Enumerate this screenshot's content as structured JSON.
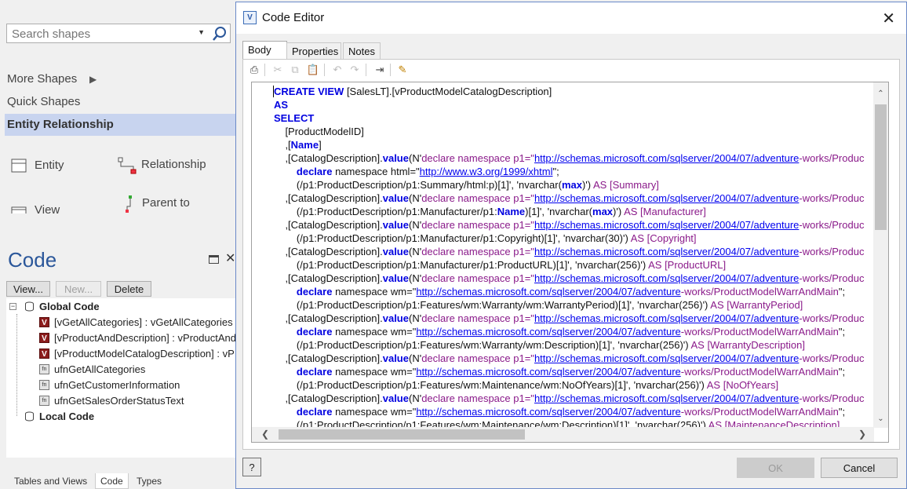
{
  "shapes_panel": {
    "search_placeholder": "Search shapes",
    "more_shapes": "More Shapes",
    "quick_shapes": "Quick Shapes",
    "entity_relationship": "Entity Relationship",
    "stencil": {
      "entity": "Entity",
      "relationship": "Relationship",
      "view": "View",
      "parent_to": "Parent to"
    }
  },
  "code_panel": {
    "title": "Code",
    "buttons": {
      "view": "View...",
      "new": "New...",
      "delete": "Delete"
    },
    "tree": {
      "global": "Global Code",
      "items": [
        "[vGetAllCategories] : vGetAllCategories",
        "[vProductAndDescription] : vProductAnd",
        "[vProductModelCatalogDescription] : vP",
        "ufnGetAllCategories",
        "ufnGetCustomerInformation",
        "ufnGetSalesOrderStatusText"
      ],
      "local": "Local Code"
    },
    "bottom_tabs": {
      "tables": "Tables and Views",
      "code": "Code",
      "types": "Types"
    }
  },
  "dialog": {
    "title": "Code Editor",
    "app_icon": "V",
    "tabs": {
      "body": "Body",
      "properties": "Properties",
      "notes": "Notes"
    },
    "toolbar_icons": [
      "print-icon",
      "cut-icon",
      "copy-icon",
      "paste-icon",
      "undo-icon",
      "redo-icon",
      "indent-icon",
      "highlight-pen-icon"
    ],
    "code_lines": [
      [
        {
          "t": "CREATE VIEW",
          "c": "kw"
        },
        {
          "t": " [SalesLT].[vProductModelCatalogDescription]",
          "c": "pun"
        }
      ],
      [
        {
          "t": "AS",
          "c": "kw"
        }
      ],
      [
        {
          "t": "SELECT",
          "c": "kw"
        }
      ],
      [
        {
          "t": "    [ProductModelID]",
          "c": "pun"
        }
      ],
      [
        {
          "t": "    ,[",
          "c": "pun"
        },
        {
          "t": "Name",
          "c": "kw"
        },
        {
          "t": "]",
          "c": "pun"
        }
      ],
      [
        {
          "t": "    ,[CatalogDescription].",
          "c": "pun"
        },
        {
          "t": "value",
          "c": "kw"
        },
        {
          "t": "(N'",
          "c": "pun"
        },
        {
          "t": "declare namespace p1=\"",
          "c": "str"
        },
        {
          "t": "http://schemas.microsoft.com/sqlserver/2004/07/adventure",
          "c": "url"
        },
        {
          "t": "-works/Produc",
          "c": "str"
        }
      ],
      [
        {
          "t": "        ",
          "c": "pun"
        },
        {
          "t": "declare",
          "c": "kw"
        },
        {
          "t": " namespace html=\"",
          "c": "pun"
        },
        {
          "t": "http://www.w3.org/1999/xhtml",
          "c": "url"
        },
        {
          "t": "\";",
          "c": "pun"
        }
      ],
      [
        {
          "t": "        (/p1:ProductDescription/p1:Summary/html:p)[1]', 'nvarchar(",
          "c": "pun"
        },
        {
          "t": "max",
          "c": "kw"
        },
        {
          "t": ")') ",
          "c": "pun"
        },
        {
          "t": "AS [Summary]",
          "c": "str"
        }
      ],
      [
        {
          "t": "    ,[CatalogDescription].",
          "c": "pun"
        },
        {
          "t": "value",
          "c": "kw"
        },
        {
          "t": "(N'",
          "c": "pun"
        },
        {
          "t": "declare namespace p1=\"",
          "c": "str"
        },
        {
          "t": "http://schemas.microsoft.com/sqlserver/2004/07/adventure",
          "c": "url"
        },
        {
          "t": "-works/Produc",
          "c": "str"
        }
      ],
      [
        {
          "t": "        (/p1:ProductDescription/p1:Manufacturer/p1:",
          "c": "pun"
        },
        {
          "t": "Name",
          "c": "kw"
        },
        {
          "t": ")[1]', 'nvarchar(",
          "c": "pun"
        },
        {
          "t": "max",
          "c": "kw"
        },
        {
          "t": ")') ",
          "c": "pun"
        },
        {
          "t": "AS [Manufacturer]",
          "c": "str"
        }
      ],
      [
        {
          "t": "    ,[CatalogDescription].",
          "c": "pun"
        },
        {
          "t": "value",
          "c": "kw"
        },
        {
          "t": "(N'",
          "c": "pun"
        },
        {
          "t": "declare namespace p1=\"",
          "c": "str"
        },
        {
          "t": "http://schemas.microsoft.com/sqlserver/2004/07/adventure",
          "c": "url"
        },
        {
          "t": "-works/Produc",
          "c": "str"
        }
      ],
      [
        {
          "t": "        (/p1:ProductDescription/p1:Manufacturer/p1:Copyright)[1]', 'nvarchar(30)') ",
          "c": "pun"
        },
        {
          "t": "AS [Copyright]",
          "c": "str"
        }
      ],
      [
        {
          "t": "    ,[CatalogDescription].",
          "c": "pun"
        },
        {
          "t": "value",
          "c": "kw"
        },
        {
          "t": "(N'",
          "c": "pun"
        },
        {
          "t": "declare namespace p1=\"",
          "c": "str"
        },
        {
          "t": "http://schemas.microsoft.com/sqlserver/2004/07/adventure",
          "c": "url"
        },
        {
          "t": "-works/Produc",
          "c": "str"
        }
      ],
      [
        {
          "t": "        (/p1:ProductDescription/p1:Manufacturer/p1:ProductURL)[1]', 'nvarchar(256)') ",
          "c": "pun"
        },
        {
          "t": "AS [ProductURL]",
          "c": "str"
        }
      ],
      [
        {
          "t": "    ,[CatalogDescription].",
          "c": "pun"
        },
        {
          "t": "value",
          "c": "kw"
        },
        {
          "t": "(N'",
          "c": "pun"
        },
        {
          "t": "declare namespace p1=\"",
          "c": "str"
        },
        {
          "t": "http://schemas.microsoft.com/sqlserver/2004/07/adventure",
          "c": "url"
        },
        {
          "t": "-works/Produc",
          "c": "str"
        }
      ],
      [
        {
          "t": "        ",
          "c": "pun"
        },
        {
          "t": "declare",
          "c": "kw"
        },
        {
          "t": " namespace wm=\"",
          "c": "pun"
        },
        {
          "t": "http://schemas.microsoft.com/sqlserver/2004/07/adventure",
          "c": "url"
        },
        {
          "t": "-works/ProductModelWarrAndMain",
          "c": "str"
        },
        {
          "t": "\";",
          "c": "pun"
        }
      ],
      [
        {
          "t": "        (/p1:ProductDescription/p1:Features/wm:Warranty/wm:WarrantyPeriod)[1]', 'nvarchar(256)') ",
          "c": "pun"
        },
        {
          "t": "AS [WarrantyPeriod]",
          "c": "str"
        }
      ],
      [
        {
          "t": "    ,[CatalogDescription].",
          "c": "pun"
        },
        {
          "t": "value",
          "c": "kw"
        },
        {
          "t": "(N'",
          "c": "pun"
        },
        {
          "t": "declare namespace p1=\"",
          "c": "str"
        },
        {
          "t": "http://schemas.microsoft.com/sqlserver/2004/07/adventure",
          "c": "url"
        },
        {
          "t": "-works/Produc",
          "c": "str"
        }
      ],
      [
        {
          "t": "        ",
          "c": "pun"
        },
        {
          "t": "declare",
          "c": "kw"
        },
        {
          "t": " namespace wm=\"",
          "c": "pun"
        },
        {
          "t": "http://schemas.microsoft.com/sqlserver/2004/07/adventure",
          "c": "url"
        },
        {
          "t": "-works/ProductModelWarrAndMain",
          "c": "str"
        },
        {
          "t": "\";",
          "c": "pun"
        }
      ],
      [
        {
          "t": "        (/p1:ProductDescription/p1:Features/wm:Warranty/wm:Description)[1]', 'nvarchar(256)') ",
          "c": "pun"
        },
        {
          "t": "AS [WarrantyDescription]",
          "c": "str"
        }
      ],
      [
        {
          "t": "    ,[CatalogDescription].",
          "c": "pun"
        },
        {
          "t": "value",
          "c": "kw"
        },
        {
          "t": "(N'",
          "c": "pun"
        },
        {
          "t": "declare namespace p1=\"",
          "c": "str"
        },
        {
          "t": "http://schemas.microsoft.com/sqlserver/2004/07/adventure",
          "c": "url"
        },
        {
          "t": "-works/Produc",
          "c": "str"
        }
      ],
      [
        {
          "t": "        ",
          "c": "pun"
        },
        {
          "t": "declare",
          "c": "kw"
        },
        {
          "t": " namespace wm=\"",
          "c": "pun"
        },
        {
          "t": "http://schemas.microsoft.com/sqlserver/2004/07/adventure",
          "c": "url"
        },
        {
          "t": "-works/ProductModelWarrAndMain",
          "c": "str"
        },
        {
          "t": "\";",
          "c": "pun"
        }
      ],
      [
        {
          "t": "        (/p1:ProductDescription/p1:Features/wm:Maintenance/wm:NoOfYears)[1]', 'nvarchar(256)') ",
          "c": "pun"
        },
        {
          "t": "AS [NoOfYears]",
          "c": "str"
        }
      ],
      [
        {
          "t": "    ,[CatalogDescription].",
          "c": "pun"
        },
        {
          "t": "value",
          "c": "kw"
        },
        {
          "t": "(N'",
          "c": "pun"
        },
        {
          "t": "declare namespace p1=\"",
          "c": "str"
        },
        {
          "t": "http://schemas.microsoft.com/sqlserver/2004/07/adventure",
          "c": "url"
        },
        {
          "t": "-works/Produc",
          "c": "str"
        }
      ],
      [
        {
          "t": "        ",
          "c": "pun"
        },
        {
          "t": "declare",
          "c": "kw"
        },
        {
          "t": " namespace wm=\"",
          "c": "pun"
        },
        {
          "t": "http://schemas.microsoft.com/sqlserver/2004/07/adventure",
          "c": "url"
        },
        {
          "t": "-works/ProductModelWarrAndMain",
          "c": "str"
        },
        {
          "t": "\";",
          "c": "pun"
        }
      ],
      [
        {
          "t": "        (/p1:ProductDescription/p1:Features/wm:Maintenance/wm:Description)[1]', 'nvarchar(256)') ",
          "c": "pun"
        },
        {
          "t": "AS [MaintenanceDescription]",
          "c": "str"
        }
      ]
    ],
    "buttons": {
      "help": "?",
      "ok": "OK",
      "cancel": "Cancel"
    }
  }
}
